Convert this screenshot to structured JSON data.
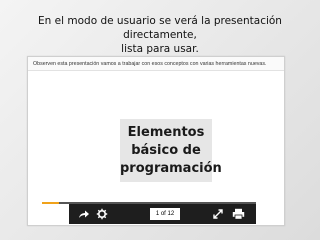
{
  "heading": {
    "line1": "En el modo de usuario se verá la presentación directamente,",
    "line2": "lista para usar."
  },
  "player": {
    "info_text": "Observen esta presentación vamos a trabajar con esos conceptos con varias herramientas nuevas.",
    "slide": {
      "title_lines": [
        "Elementos",
        "básico de",
        "programación"
      ]
    },
    "progress": {
      "fraction": 0.08,
      "color": "#f0a21a"
    },
    "controls": {
      "counter": "1 of 12",
      "icons": [
        "share-arrow-icon",
        "gear-icon",
        "fullscreen-icon",
        "print-icon"
      ]
    }
  }
}
